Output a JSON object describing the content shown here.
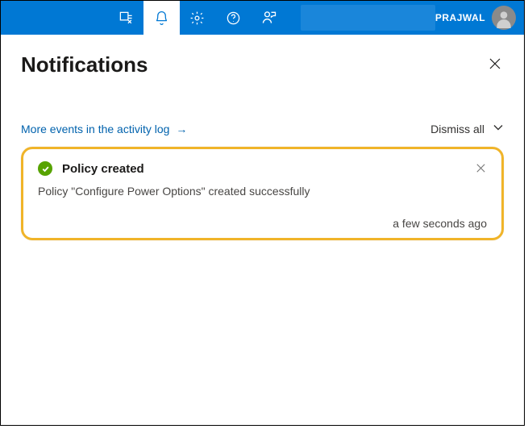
{
  "header": {
    "user_name": "PRAJWAL",
    "icons": {
      "filter": "filter-icon",
      "bell": "bell-icon",
      "gear": "gear-icon",
      "help": "help-icon",
      "feedback": "feedback-icon"
    }
  },
  "panel": {
    "title": "Notifications",
    "activity_link": "More events in the activity log",
    "dismiss_all": "Dismiss all"
  },
  "notification": {
    "title": "Policy created",
    "message": "Policy \"Configure Power Options\" created successfully",
    "time": "a few seconds ago",
    "status": "success"
  },
  "colors": {
    "brand": "#0078d4",
    "link": "#0062ad",
    "highlight_border": "#f0b429",
    "success": "#57a300"
  }
}
